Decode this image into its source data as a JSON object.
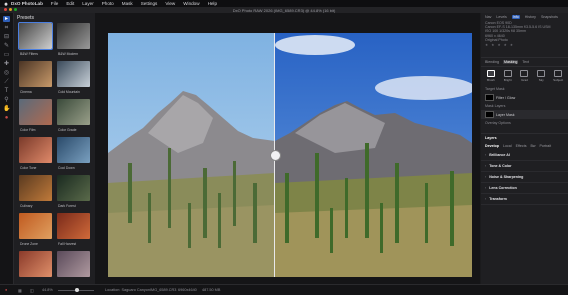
{
  "menubar": {
    "app": "DxO PhotoLab",
    "items": [
      "File",
      "Edit",
      "Layer",
      "Photo",
      "Mask",
      "Settings",
      "View",
      "Window",
      "Help"
    ]
  },
  "window": {
    "title": "DxO Photo RAW 2026 (IMG_6589.CR3) @ 44.8% (16 bit)"
  },
  "tools": [
    "select-icon",
    "crop-icon",
    "horizon-icon",
    "brush-icon",
    "eraser-icon",
    "healing-icon",
    "clone-icon",
    "eyedropper-icon",
    "type-icon",
    "zoom-icon",
    "hand-icon",
    "color-icon"
  ],
  "presets": {
    "title": "Presets",
    "items": [
      {
        "label": "B&W Filters",
        "color1": "#444444",
        "color2": "#cfcfcf"
      },
      {
        "label": "B&W Modern",
        "color1": "#2d2d2d",
        "color2": "#9a9a9a"
      },
      {
        "label": "Cinema",
        "color1": "#4a3424",
        "color2": "#c89a6a"
      },
      {
        "label": "Cold Mountain",
        "color1": "#3a4a5a",
        "color2": "#c8d0d8"
      },
      {
        "label": "Color Film",
        "color1": "#5a6a7a",
        "color2": "#b06a50"
      },
      {
        "label": "Color Grade",
        "color1": "#3a4a3a",
        "color2": "#9aa08a"
      },
      {
        "label": "Color Tone",
        "color1": "#7a3a2a",
        "color2": "#e08a6a"
      },
      {
        "label": "Cool Down",
        "color1": "#2a4a6a",
        "color2": "#7aa0c0"
      },
      {
        "label": "Culinary",
        "color1": "#5a3a20",
        "color2": "#c07a3a"
      },
      {
        "label": "Dark Forest",
        "color1": "#1a2a20",
        "color2": "#5a6a4a"
      },
      {
        "label": "Drone Zone",
        "color1": "#c05a20",
        "color2": "#e0a060"
      },
      {
        "label": "Fall Harvest",
        "color1": "#7a2a1a",
        "color2": "#d06a3a"
      },
      {
        "label": "",
        "color1": "#8a3a2a",
        "color2": "#e0906a"
      },
      {
        "label": "",
        "color1": "#5a4a5a",
        "color2": "#b09aa0"
      }
    ]
  },
  "right": {
    "tabs": [
      "Nav",
      "Levels",
      "Info",
      "History",
      "Snapshots"
    ],
    "active_tab": "Info",
    "meta": [
      "Canon EOS 90D",
      "Canon EF-S 18-135mm f/3.5-5.6 IS USM",
      "ISO 100  1/320s  f/8  35mm",
      "6960 x 4640",
      "Original Photo"
    ],
    "stars": "★ ★ ★ ★ ★",
    "subtabs": [
      "Blending",
      "Masking",
      "Text"
    ],
    "active_subtab": "Masking",
    "mask_tools": [
      {
        "label": "Brush"
      },
      {
        "label": "Bright"
      },
      {
        "label": "Grad"
      },
      {
        "label": "Sky"
      },
      {
        "label": "Subject"
      },
      {
        "label": "Color"
      }
    ],
    "target_label": "Target Mask",
    "layers": [
      {
        "label": "Filter / Glow"
      },
      {
        "label": "Mask Layers"
      },
      {
        "label": "Layer Mask"
      },
      {
        "label": "Overlay Options"
      }
    ],
    "layers_title": "Layers",
    "dev_tabs": [
      "Develop",
      "Local",
      "Effects",
      "Bw",
      "Portrait"
    ],
    "sections": [
      "Brilliance AI",
      "Tone & Color",
      "Noise & Sharpening",
      "Lens Correction",
      "Transform"
    ]
  },
  "bottombar": {
    "zoom": "44.8%",
    "location_label": "Location: Saguaro Canyon",
    "file_label": "IMG_6589.CR3",
    "dims_label": "6960x4640",
    "size_label": "487.50 MB"
  },
  "colors": {
    "accent": "#2f5fb8",
    "bg": "#1b1b1d",
    "panel": "#1f1f22"
  }
}
